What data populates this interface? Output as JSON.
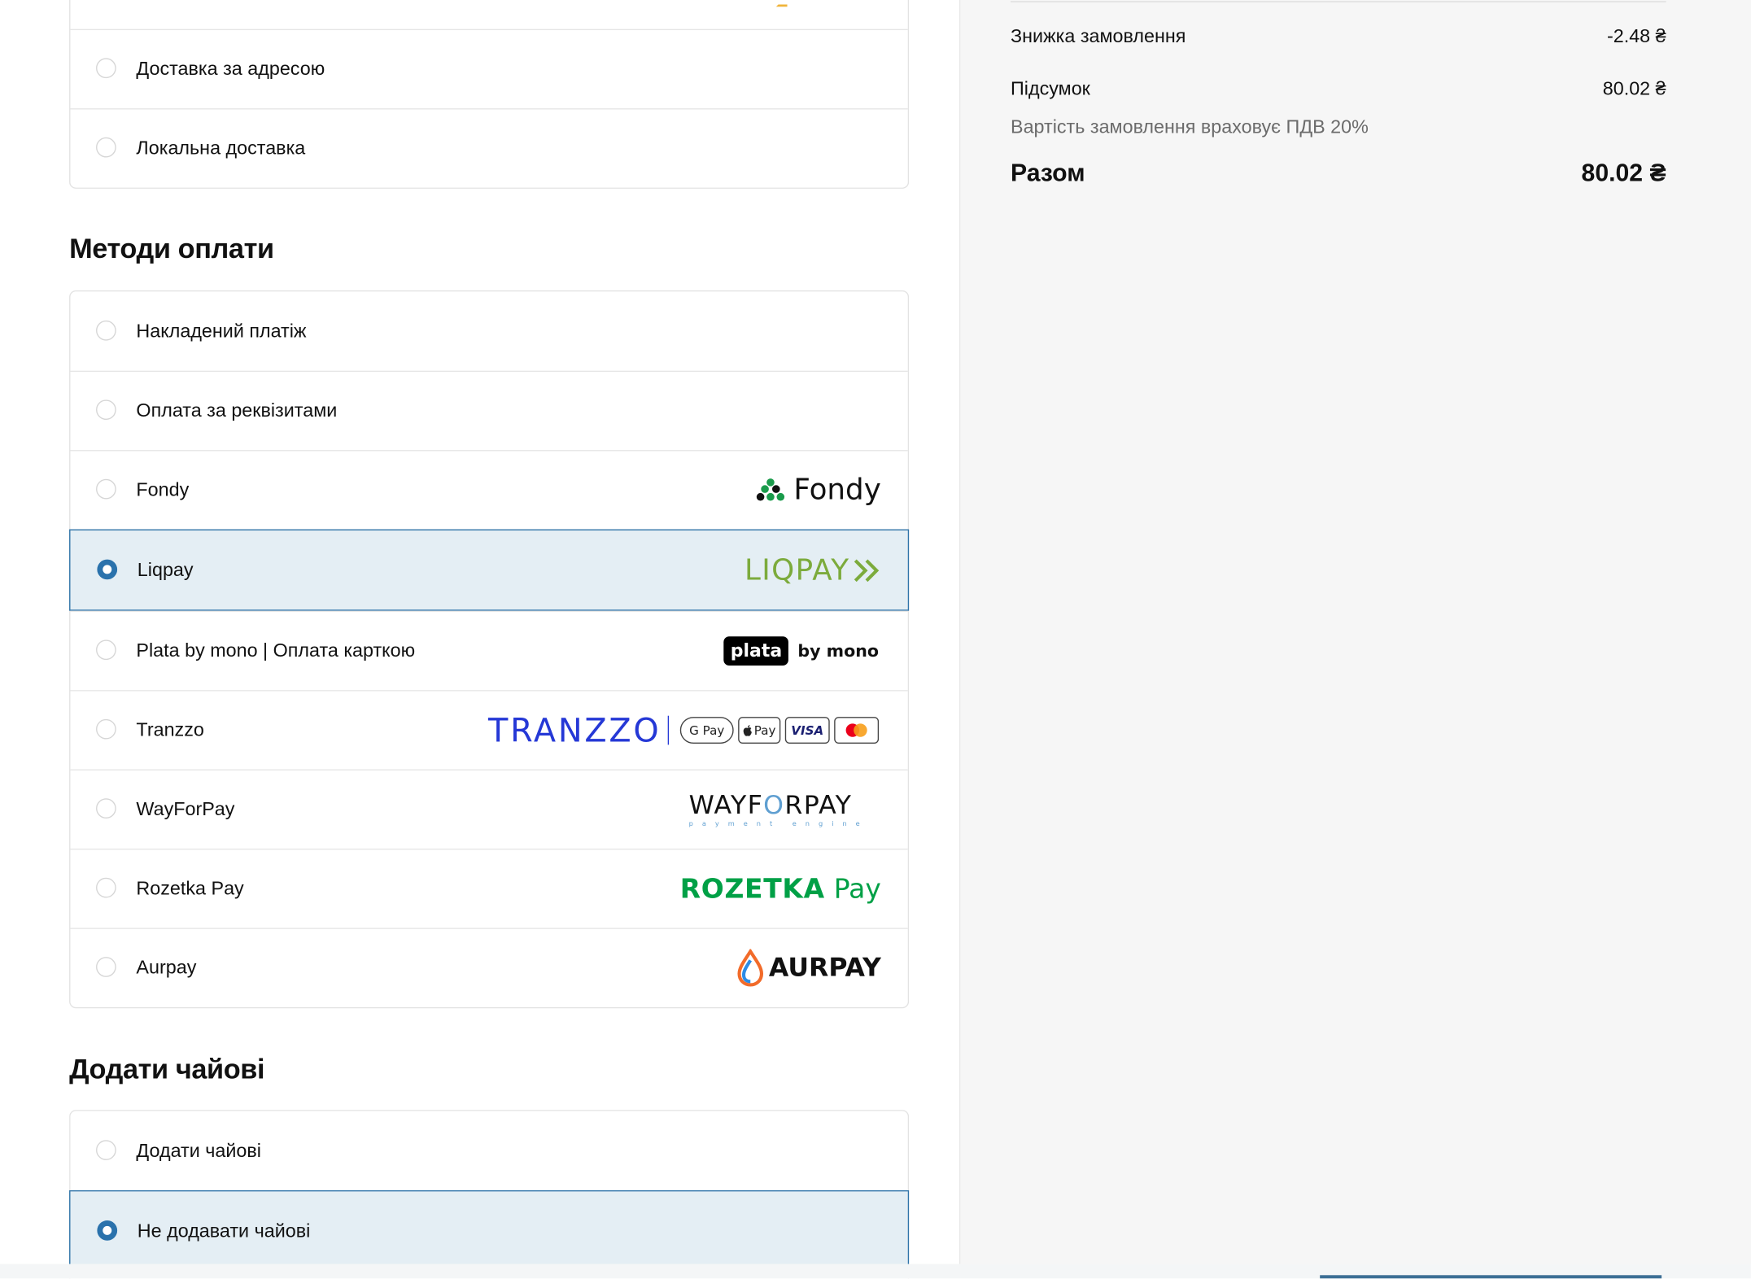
{
  "delivery": {
    "options": [
      {
        "label": "Доставка за адресою",
        "selected": false
      },
      {
        "label": "Локальна доставка",
        "selected": false
      }
    ]
  },
  "payment": {
    "title": "Методи оплати",
    "options": [
      {
        "label": "Накладений платіж",
        "selected": false
      },
      {
        "label": "Оплата за реквізитами",
        "selected": false
      },
      {
        "label": "Fondy",
        "selected": false,
        "logo": "Fondy"
      },
      {
        "label": "Liqpay",
        "selected": true,
        "logo": "LIQPAY"
      },
      {
        "label": "Plata by mono | Оплата карткою",
        "selected": false,
        "logo_badge": "plata",
        "logo_suffix": "by mono"
      },
      {
        "label": "Tranzzo",
        "selected": false,
        "logo": "TRANZZO",
        "chips": [
          "G Pay",
          "Pay",
          "VISA"
        ]
      },
      {
        "label": "WayForPay",
        "selected": false,
        "logo_a": "WAYF",
        "logo_o": "O",
        "logo_b": "RPAY",
        "logo_sub": "payment engine"
      },
      {
        "label": "Rozetka Pay",
        "selected": false,
        "logo_main": "ROZETKA",
        "logo_pay": "Pay"
      },
      {
        "label": "Aurpay",
        "selected": false,
        "logo": "AURPAY"
      }
    ]
  },
  "tips": {
    "title": "Додати чайові",
    "options": [
      {
        "label": "Додати чайові",
        "selected": false
      },
      {
        "label": "Не додавати чайові",
        "selected": true
      }
    ]
  },
  "summary": {
    "discount_label": "Знижка замовлення",
    "discount_value": "-2.48 ₴",
    "subtotal_label": "Підсумок",
    "subtotal_value": "80.02 ₴",
    "vat_note": "Вартість замовлення враховує ПДВ 20%",
    "total_label": "Разом",
    "total_value": "80.02 ₴"
  },
  "colors": {
    "accent": "#2a72ac",
    "selected_bg": "#e4eef4",
    "liqpay": "#7cab3c",
    "tranzzo": "#2538d6",
    "rozetka": "#00a046"
  }
}
